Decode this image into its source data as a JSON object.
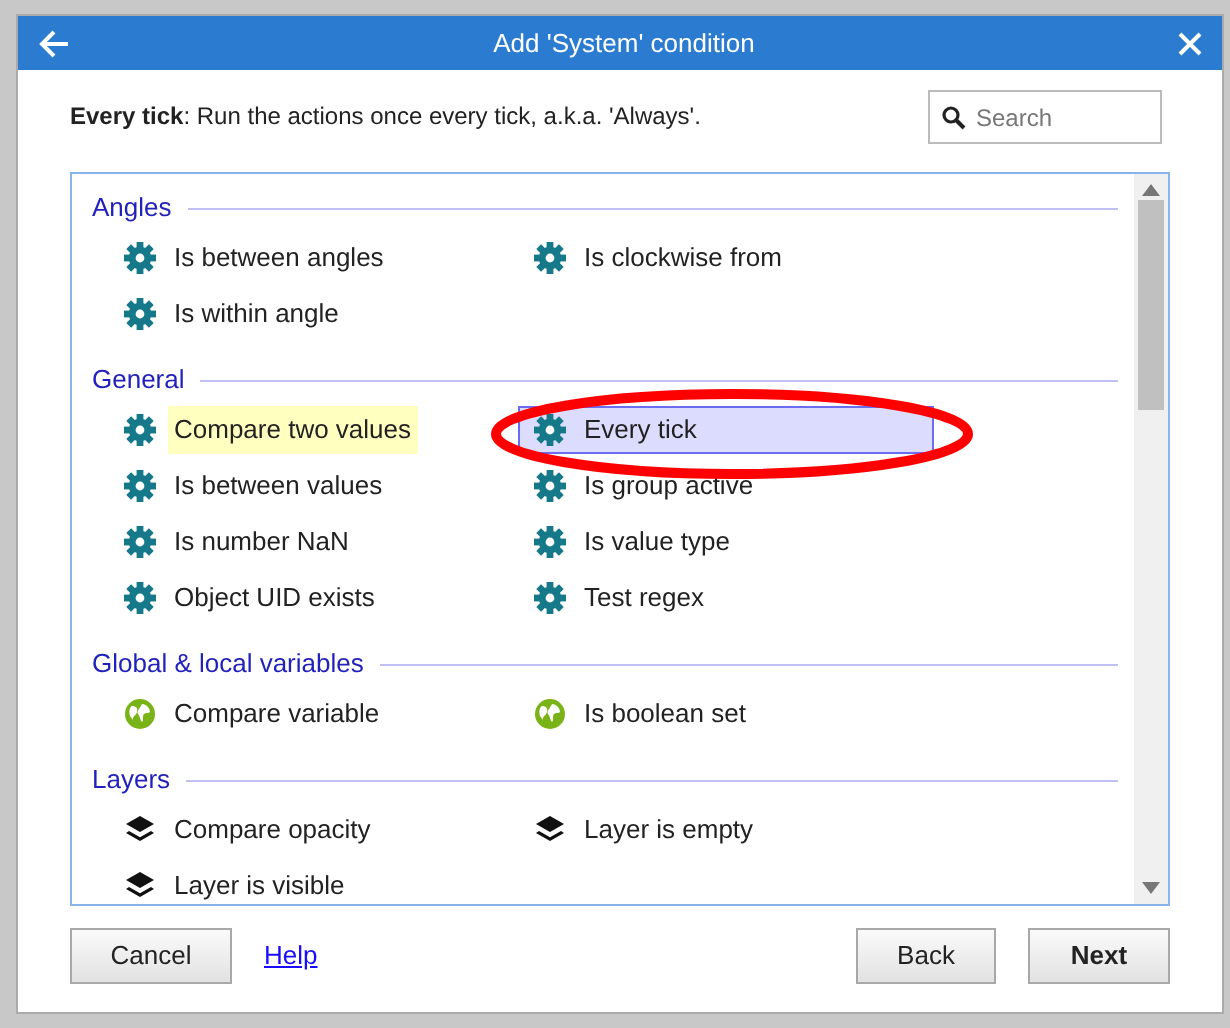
{
  "window": {
    "title": "Add 'System' condition"
  },
  "description": "**Every tick**: Run the actions once every tick, a.k.a. 'Always'.",
  "search": {
    "placeholder": "Search"
  },
  "sections": [
    {
      "title": "Angles",
      "kind": "gear",
      "items": [
        {
          "label": "Is between angles",
          "selected": false,
          "highlighted": false
        },
        {
          "label": "Is clockwise from",
          "selected": false,
          "highlighted": false
        },
        {
          "label": "Is within angle",
          "selected": false,
          "highlighted": false
        }
      ]
    },
    {
      "title": "General",
      "kind": "gear",
      "items": [
        {
          "label": "Compare two values",
          "selected": false,
          "highlighted": true
        },
        {
          "label": "Every tick",
          "selected": true,
          "highlighted": false
        },
        {
          "label": "Is between values",
          "selected": false,
          "highlighted": false
        },
        {
          "label": "Is group active",
          "selected": false,
          "highlighted": false
        },
        {
          "label": "Is number NaN",
          "selected": false,
          "highlighted": false
        },
        {
          "label": "Is value type",
          "selected": false,
          "highlighted": false
        },
        {
          "label": "Object UID exists",
          "selected": false,
          "highlighted": false
        },
        {
          "label": "Test regex",
          "selected": false,
          "highlighted": false
        }
      ]
    },
    {
      "title": "Global & local variables",
      "kind": "globe",
      "items": [
        {
          "label": "Compare variable",
          "selected": false,
          "highlighted": false
        },
        {
          "label": "Is boolean set",
          "selected": false,
          "highlighted": false
        }
      ]
    },
    {
      "title": "Layers",
      "kind": "layers",
      "items": [
        {
          "label": "Compare opacity",
          "selected": false,
          "highlighted": false
        },
        {
          "label": "Layer is empty",
          "selected": false,
          "highlighted": false
        },
        {
          "label": "Layer is visible",
          "selected": false,
          "highlighted": false
        }
      ]
    }
  ],
  "annotations": [
    {
      "kind": "ellipse"
    }
  ],
  "buttons": {
    "cancel": "Cancel",
    "help": "Help",
    "back": "Back",
    "next": "Next"
  }
}
